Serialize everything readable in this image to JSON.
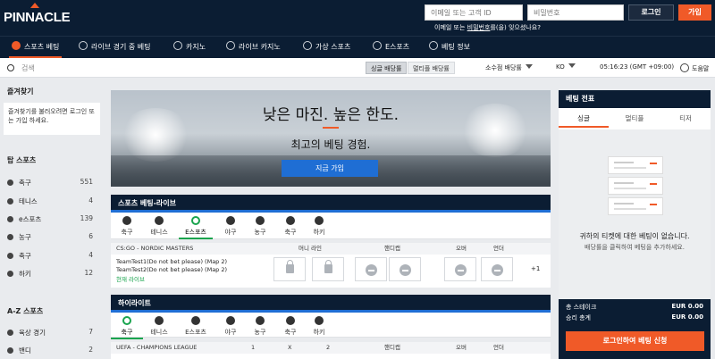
{
  "header": {
    "logo": "PINNACLE",
    "email_placeholder": "이메일 또는 고객 ID",
    "password_placeholder": "비밀번호",
    "login_label": "로그인",
    "join_label": "가입",
    "forgot_prefix": "이메일 또는 ",
    "forgot_link": "비밀번호",
    "forgot_suffix": "를(을) 잊으셨나요?"
  },
  "nav": {
    "items": [
      {
        "label": "스포츠 베팅",
        "icon": "soccer-ball-icon"
      },
      {
        "label": "라이브 경기 중 베팅",
        "icon": "live-icon"
      },
      {
        "label": "카지노",
        "icon": "cards-icon"
      },
      {
        "label": "라이브 카지노",
        "icon": "chip-icon"
      },
      {
        "label": "가상 스포츠",
        "icon": "monitor-icon"
      },
      {
        "label": "E스포츠",
        "icon": "gamepad-icon"
      },
      {
        "label": "베팅 정보",
        "icon": "book-icon"
      }
    ]
  },
  "subbar": {
    "search_placeholder": "검색",
    "single_label": "싱글 배당률",
    "multi_label": "멀티플 배당률",
    "odds_format": "소수점 배당률",
    "language": "KO",
    "time": "05:16:23 (GMT +09:00)",
    "help": "도움말"
  },
  "sidebar": {
    "favorites_title": "즐겨찾기",
    "favorites_text": "즐겨찾기를 불러오려면 로그인 또는 가입 하세요.",
    "top_sports_title": "탑 스포츠",
    "top_sports": [
      {
        "name": "축구",
        "count": "551"
      },
      {
        "name": "테니스",
        "count": "4"
      },
      {
        "name": "e스포츠",
        "count": "139"
      },
      {
        "name": "농구",
        "count": "6"
      },
      {
        "name": "축구",
        "count": "4"
      },
      {
        "name": "하키",
        "count": "12"
      }
    ],
    "az_title": "A-Z 스포츠",
    "az_sports": [
      {
        "name": "육상 경기",
        "count": "7"
      },
      {
        "name": "밴디",
        "count": "2"
      }
    ]
  },
  "hero": {
    "title": "낮은 마진. 높은 한도.",
    "subtitle": "최고의 베팅 경험.",
    "button": "지금 가입"
  },
  "live": {
    "title": "스포츠 베팅-라이브",
    "tabs": [
      "축구",
      "테니스",
      "E스포츠",
      "야구",
      "농구",
      "축구",
      "하키"
    ],
    "league": "CS:GO - NORDIC MASTERS",
    "col_moneyline": "머니 라인",
    "col_handicap": "핸디캡",
    "col_over": "오버",
    "col_under": "언더",
    "team1": "TeamTest1(Do not bet please) (Map 2)",
    "team2": "TeamTest2(Do not bet please) (Map 2)",
    "status": "현재 라이브",
    "more": "+1"
  },
  "highlights": {
    "title": "하이라이트",
    "tabs": [
      "축구",
      "테니스",
      "E스포츠",
      "야구",
      "농구",
      "축구",
      "하키"
    ],
    "league": "UEFA - CHAMPIONS LEAGUE",
    "col_1": "1",
    "col_x": "X",
    "col_2": "2",
    "col_handicap": "핸디캡",
    "col_over": "오버",
    "col_under": "언더"
  },
  "betslip": {
    "title": "베팅 전표",
    "tabs": [
      "싱글",
      "멀티플",
      "티저"
    ],
    "empty_title": "귀하의 티켓에 대한 베팅이 없습니다.",
    "empty_sub": "배당률을 클릭하여 베팅을 추가하세요.",
    "total_stake_label": "총 스테이크",
    "total_stake": "EUR 0.00",
    "total_win_label": "승리 총계",
    "total_win": "EUR 0.00",
    "button": "로그인하여 베팅 신청"
  },
  "colors": {
    "brand": "#0b1d33",
    "accent": "#f05a28",
    "primary": "#1f6ed4",
    "live": "#1aa44e"
  }
}
